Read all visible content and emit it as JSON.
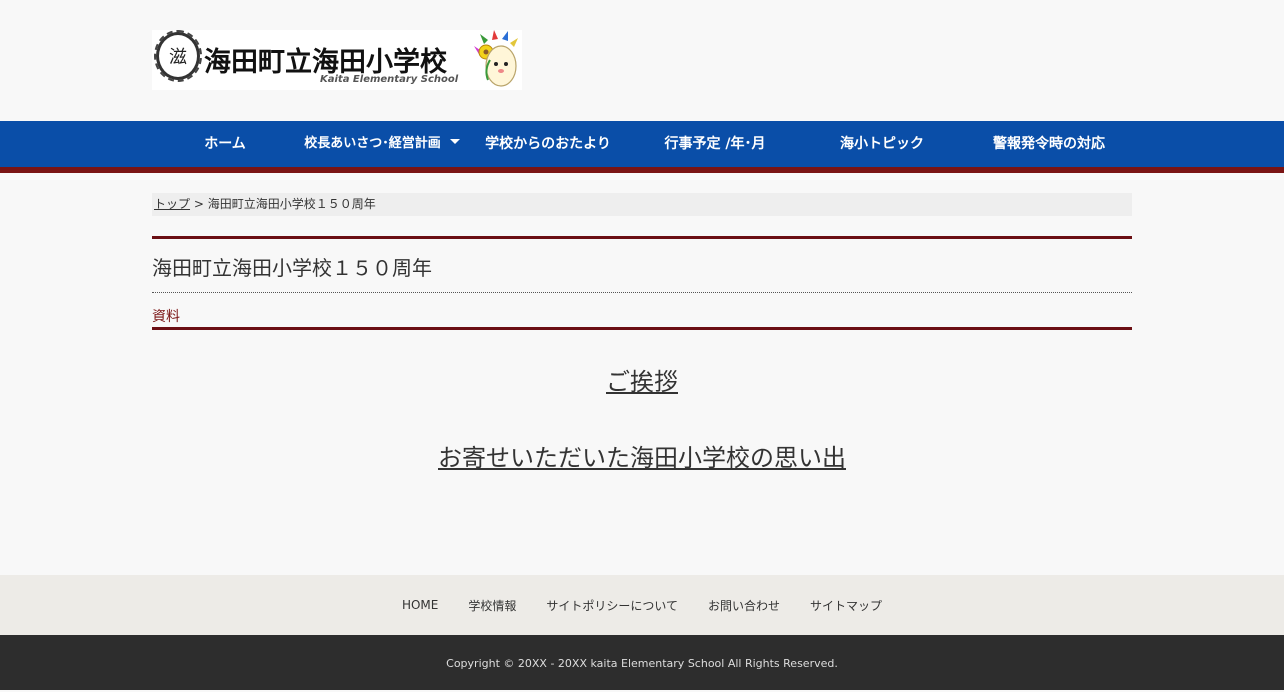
{
  "header": {
    "logo_title": "海田町立海田小学校",
    "logo_subtitle": "Kaita Elementary School",
    "logo_seal_glyph": "滋"
  },
  "nav": {
    "items": [
      {
        "label": "ホーム"
      },
      {
        "label": "校長あいさつ･経営計画",
        "has_dropdown": true
      },
      {
        "label": "学校からのおたより"
      },
      {
        "label": "行事予定 /年･月"
      },
      {
        "label": "海小トピック"
      },
      {
        "label": "警報発令時の対応"
      }
    ],
    "bg_color": "#0a4ea8",
    "stripe_color": "#7a1414"
  },
  "breadcrumb": {
    "home": "トップ",
    "separator": ">",
    "current": "海田町立海田小学校１５０周年"
  },
  "page": {
    "title": "海田町立海田小学校１５０周年",
    "section_label": "資料",
    "links": [
      {
        "label": "ご挨拶"
      },
      {
        "label": "お寄せいただいた海田小学校の思い出"
      }
    ],
    "accent_color": "#6b0f14"
  },
  "footer": {
    "links": [
      "HOME",
      "学校情報",
      "サイトポリシーについて",
      "お問い合わせ",
      "サイトマップ"
    ],
    "copyright": "Copyright © 20XX - 20XX kaita Elementary School All Rights Reserved."
  }
}
